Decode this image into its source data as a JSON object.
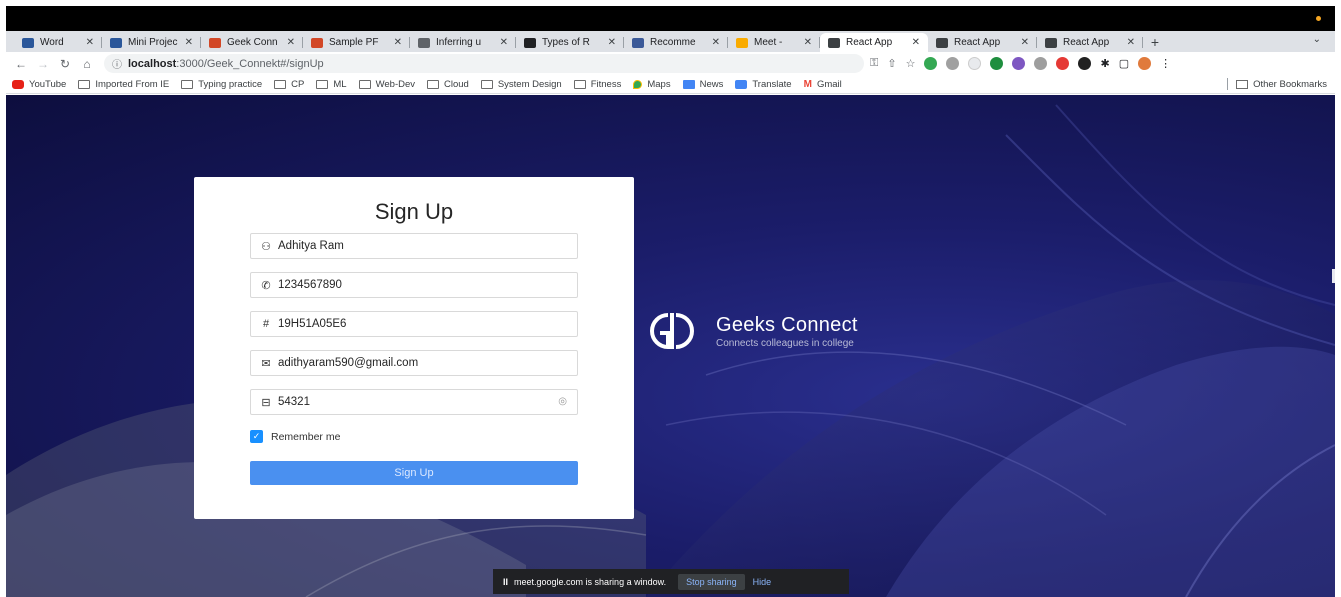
{
  "browser": {
    "tabs": [
      {
        "title": "Word",
        "color": "#2b579a",
        "active": false
      },
      {
        "title": "Mini Projec",
        "color": "#2b579a",
        "active": false
      },
      {
        "title": "Geek Conn",
        "color": "#d24726",
        "active": false
      },
      {
        "title": "Sample PF",
        "color": "#d24726",
        "active": false
      },
      {
        "title": "Inferring u",
        "color": "#5f6368",
        "active": false
      },
      {
        "title": "Types of R",
        "color": "#202124",
        "active": false
      },
      {
        "title": "Recomme",
        "color": "#3b5998",
        "active": false
      },
      {
        "title": "Meet -",
        "color": "#f9ab00",
        "active": false
      },
      {
        "title": "React App",
        "color": "#3c4043",
        "active": true
      },
      {
        "title": "React App",
        "color": "#3c4043",
        "active": false
      },
      {
        "title": "React App",
        "color": "#3c4043",
        "active": false
      }
    ],
    "new_tab": "+",
    "url_host": "localhost",
    "url_path": ":3000/Geek_Connekt#/signUp",
    "bookmarks": [
      {
        "label": "YouTube",
        "icon": "yt"
      },
      {
        "label": "Imported From IE",
        "icon": "folder"
      },
      {
        "label": "Typing practice",
        "icon": "folder"
      },
      {
        "label": "CP",
        "icon": "folder"
      },
      {
        "label": "ML",
        "icon": "folder"
      },
      {
        "label": "Web-Dev",
        "icon": "folder"
      },
      {
        "label": "Cloud",
        "icon": "folder"
      },
      {
        "label": "System Design",
        "icon": "folder"
      },
      {
        "label": "Fitness",
        "icon": "folder"
      },
      {
        "label": "Maps",
        "icon": "maps"
      },
      {
        "label": "News",
        "icon": "news"
      },
      {
        "label": "Translate",
        "icon": "tr"
      },
      {
        "label": "Gmail",
        "icon": "gm"
      }
    ],
    "other_bookmarks": "Other Bookmarks"
  },
  "signup": {
    "title": "Sign Up",
    "name_value": "Adhitya Ram",
    "phone_value": "1234567890",
    "roll_value": "19H51A05E6",
    "email_value": "adithyaram590@gmail.com",
    "password_value": "54321",
    "remember_label": "Remember me",
    "remember_checked": true,
    "submit_label": "Sign Up"
  },
  "brand": {
    "name": "Geeks Connect",
    "tagline": "Connects colleagues in college"
  },
  "share_bar": {
    "message": "meet.google.com is sharing a window.",
    "stop_label": "Stop sharing",
    "hide_label": "Hide"
  },
  "colors": {
    "background": "#1b1d6a",
    "primary_button": "#4a90f0",
    "checkbox": "#1890ff"
  }
}
